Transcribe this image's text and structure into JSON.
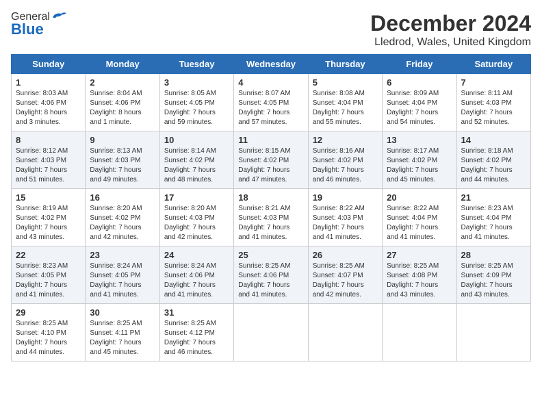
{
  "header": {
    "logo_general": "General",
    "logo_blue": "Blue",
    "title": "December 2024",
    "subtitle": "Lledrod, Wales, United Kingdom"
  },
  "days_of_week": [
    "Sunday",
    "Monday",
    "Tuesday",
    "Wednesday",
    "Thursday",
    "Friday",
    "Saturday"
  ],
  "weeks": [
    [
      {
        "day": "1",
        "detail": "Sunrise: 8:03 AM\nSunset: 4:06 PM\nDaylight: 8 hours\nand 3 minutes."
      },
      {
        "day": "2",
        "detail": "Sunrise: 8:04 AM\nSunset: 4:06 PM\nDaylight: 8 hours\nand 1 minute."
      },
      {
        "day": "3",
        "detail": "Sunrise: 8:05 AM\nSunset: 4:05 PM\nDaylight: 7 hours\nand 59 minutes."
      },
      {
        "day": "4",
        "detail": "Sunrise: 8:07 AM\nSunset: 4:05 PM\nDaylight: 7 hours\nand 57 minutes."
      },
      {
        "day": "5",
        "detail": "Sunrise: 8:08 AM\nSunset: 4:04 PM\nDaylight: 7 hours\nand 55 minutes."
      },
      {
        "day": "6",
        "detail": "Sunrise: 8:09 AM\nSunset: 4:04 PM\nDaylight: 7 hours\nand 54 minutes."
      },
      {
        "day": "7",
        "detail": "Sunrise: 8:11 AM\nSunset: 4:03 PM\nDaylight: 7 hours\nand 52 minutes."
      }
    ],
    [
      {
        "day": "8",
        "detail": "Sunrise: 8:12 AM\nSunset: 4:03 PM\nDaylight: 7 hours\nand 51 minutes."
      },
      {
        "day": "9",
        "detail": "Sunrise: 8:13 AM\nSunset: 4:03 PM\nDaylight: 7 hours\nand 49 minutes."
      },
      {
        "day": "10",
        "detail": "Sunrise: 8:14 AM\nSunset: 4:02 PM\nDaylight: 7 hours\nand 48 minutes."
      },
      {
        "day": "11",
        "detail": "Sunrise: 8:15 AM\nSunset: 4:02 PM\nDaylight: 7 hours\nand 47 minutes."
      },
      {
        "day": "12",
        "detail": "Sunrise: 8:16 AM\nSunset: 4:02 PM\nDaylight: 7 hours\nand 46 minutes."
      },
      {
        "day": "13",
        "detail": "Sunrise: 8:17 AM\nSunset: 4:02 PM\nDaylight: 7 hours\nand 45 minutes."
      },
      {
        "day": "14",
        "detail": "Sunrise: 8:18 AM\nSunset: 4:02 PM\nDaylight: 7 hours\nand 44 minutes."
      }
    ],
    [
      {
        "day": "15",
        "detail": "Sunrise: 8:19 AM\nSunset: 4:02 PM\nDaylight: 7 hours\nand 43 minutes."
      },
      {
        "day": "16",
        "detail": "Sunrise: 8:20 AM\nSunset: 4:02 PM\nDaylight: 7 hours\nand 42 minutes."
      },
      {
        "day": "17",
        "detail": "Sunrise: 8:20 AM\nSunset: 4:03 PM\nDaylight: 7 hours\nand 42 minutes."
      },
      {
        "day": "18",
        "detail": "Sunrise: 8:21 AM\nSunset: 4:03 PM\nDaylight: 7 hours\nand 41 minutes."
      },
      {
        "day": "19",
        "detail": "Sunrise: 8:22 AM\nSunset: 4:03 PM\nDaylight: 7 hours\nand 41 minutes."
      },
      {
        "day": "20",
        "detail": "Sunrise: 8:22 AM\nSunset: 4:04 PM\nDaylight: 7 hours\nand 41 minutes."
      },
      {
        "day": "21",
        "detail": "Sunrise: 8:23 AM\nSunset: 4:04 PM\nDaylight: 7 hours\nand 41 minutes."
      }
    ],
    [
      {
        "day": "22",
        "detail": "Sunrise: 8:23 AM\nSunset: 4:05 PM\nDaylight: 7 hours\nand 41 minutes."
      },
      {
        "day": "23",
        "detail": "Sunrise: 8:24 AM\nSunset: 4:05 PM\nDaylight: 7 hours\nand 41 minutes."
      },
      {
        "day": "24",
        "detail": "Sunrise: 8:24 AM\nSunset: 4:06 PM\nDaylight: 7 hours\nand 41 minutes."
      },
      {
        "day": "25",
        "detail": "Sunrise: 8:25 AM\nSunset: 4:06 PM\nDaylight: 7 hours\nand 41 minutes."
      },
      {
        "day": "26",
        "detail": "Sunrise: 8:25 AM\nSunset: 4:07 PM\nDaylight: 7 hours\nand 42 minutes."
      },
      {
        "day": "27",
        "detail": "Sunrise: 8:25 AM\nSunset: 4:08 PM\nDaylight: 7 hours\nand 43 minutes."
      },
      {
        "day": "28",
        "detail": "Sunrise: 8:25 AM\nSunset: 4:09 PM\nDaylight: 7 hours\nand 43 minutes."
      }
    ],
    [
      {
        "day": "29",
        "detail": "Sunrise: 8:25 AM\nSunset: 4:10 PM\nDaylight: 7 hours\nand 44 minutes."
      },
      {
        "day": "30",
        "detail": "Sunrise: 8:25 AM\nSunset: 4:11 PM\nDaylight: 7 hours\nand 45 minutes."
      },
      {
        "day": "31",
        "detail": "Sunrise: 8:25 AM\nSunset: 4:12 PM\nDaylight: 7 hours\nand 46 minutes."
      },
      {
        "day": "",
        "detail": ""
      },
      {
        "day": "",
        "detail": ""
      },
      {
        "day": "",
        "detail": ""
      },
      {
        "day": "",
        "detail": ""
      }
    ]
  ]
}
